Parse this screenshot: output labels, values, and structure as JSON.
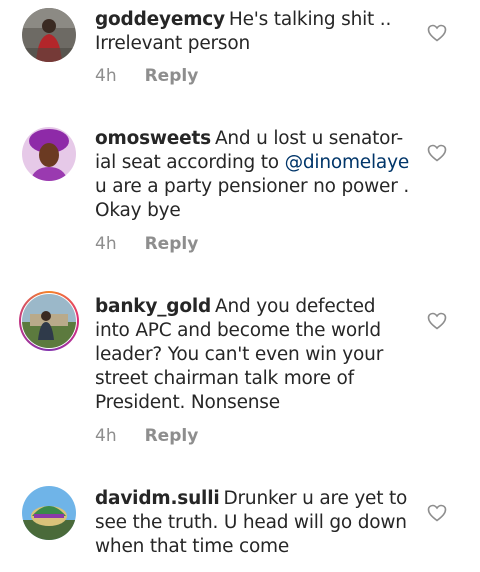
{
  "comments": [
    {
      "username": "goddeyemcy",
      "text": "He's talking shit ..\nIrrelevant person",
      "mention": "",
      "text_after": "",
      "time": "4h",
      "reply_label": "Reply"
    },
    {
      "username": "omosweets",
      "text": "And u lost u senator-\nial seat according to ",
      "mention": "@dinomelaye",
      "text_after": "\nu are a party pensioner no power .\nOkay bye",
      "time": "4h",
      "reply_label": "Reply"
    },
    {
      "username": "banky_gold",
      "text": "And you defected\ninto APC and become the world\nleader? You can't even win your\nstreet chairman talk more of\nPresident. Nonsense",
      "mention": "",
      "text_after": "",
      "time": "4h",
      "reply_label": "Reply"
    },
    {
      "username": "davidm.sulli",
      "text": "Drunker u are yet to\nsee the truth. U head will go down\nwhen that time come",
      "mention": "",
      "text_after": "",
      "time": "",
      "reply_label": ""
    }
  ]
}
